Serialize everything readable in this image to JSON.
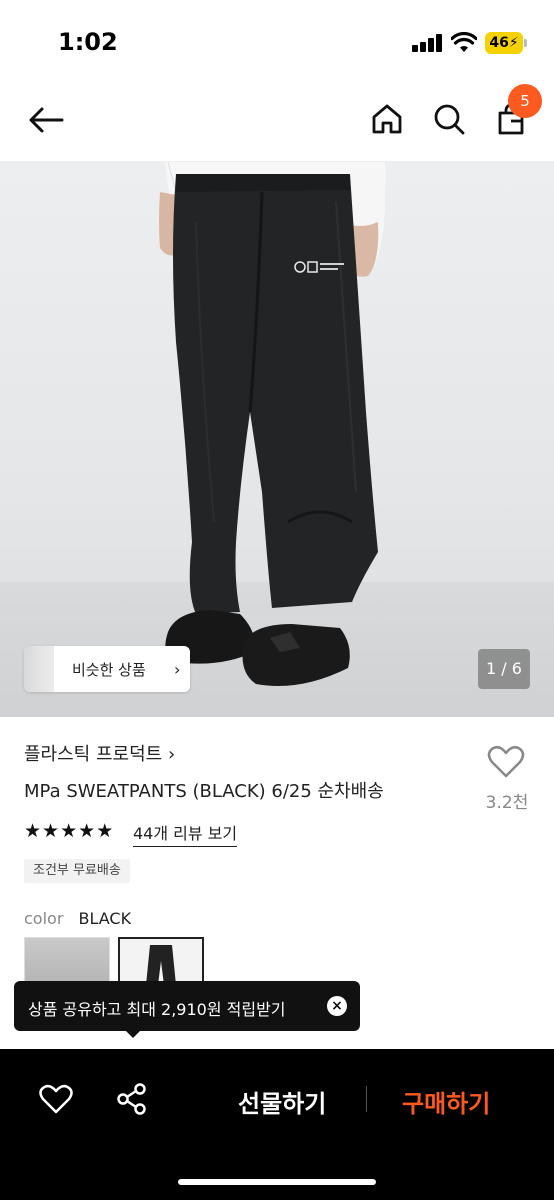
{
  "status_bar": {
    "time": "1:02",
    "battery": "46"
  },
  "header": {
    "cart_count": "5"
  },
  "hero": {
    "similar_label": "비슷한 상품",
    "pager": "1 / 6"
  },
  "product": {
    "brand": "플라스틱 프로덕트",
    "title": "MPa SWEATPANTS (BLACK) 6/25 순차배송",
    "like_count": "3.2천",
    "rating": 5,
    "reviews": "44개 리뷰 보기",
    "shipping_tag": "조건부 무료배송",
    "color_label": "color",
    "color_value": "BLACK"
  },
  "toast": {
    "message": "상품 공유하고 최대 2,910원 적립받기"
  },
  "bottom_bar": {
    "gift_label": "선물하기",
    "buy_label": "구매하기"
  },
  "colors": {
    "accent": "#ff5a1f",
    "bottom_bg": "#000000"
  }
}
